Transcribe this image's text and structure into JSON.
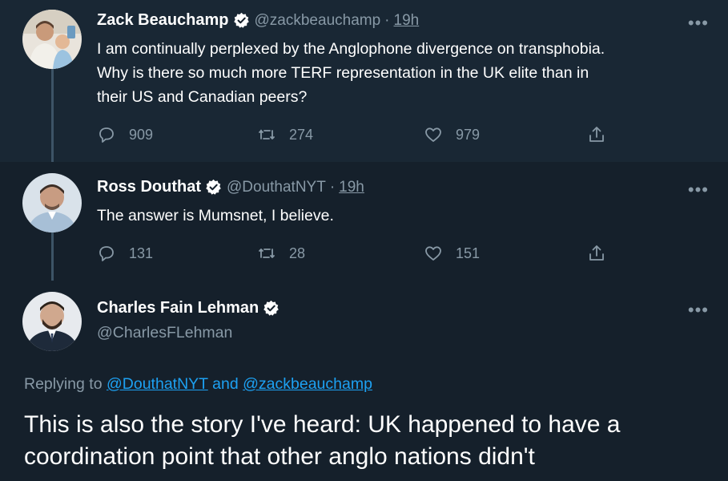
{
  "tweets": [
    {
      "name": "Zack Beauchamp",
      "handle": "@zackbeauchamp",
      "separator": "·",
      "time": "19h",
      "text_lines": [
        "I am continually perplexed by the Anglophone divergence on transphobia.",
        "Why is there so much more TERF representation in the UK elite than in",
        "their US and Canadian peers?"
      ],
      "replies": "909",
      "retweets": "274",
      "likes": "979"
    },
    {
      "name": "Ross Douthat",
      "handle": "@DouthatNYT",
      "separator": "·",
      "time": "19h",
      "text_lines": [
        "The answer is Mumsnet, I believe."
      ],
      "replies": "131",
      "retweets": "28",
      "likes": "151"
    }
  ],
  "focused": {
    "name": "Charles Fain Lehman",
    "handle": "@CharlesFLehman",
    "replying_prefix": "Replying to",
    "mention1": "@DouthatNYT",
    "and_word": "and",
    "mention2": "@zackbeauchamp",
    "text_lines": [
      "This is also the story I've heard: UK happened to have a",
      "coordination point that other anglo nations didn't"
    ]
  },
  "more_glyph": "•••",
  "colors": {
    "background": "#15202b",
    "highlight_background": "#192734",
    "secondary_text": "#8899a6",
    "link": "#1da1f2",
    "thread_line": "#3d5466"
  },
  "icons": [
    "verified-badge-icon",
    "reply-icon",
    "retweet-icon",
    "like-icon",
    "share-icon",
    "more-icon"
  ]
}
